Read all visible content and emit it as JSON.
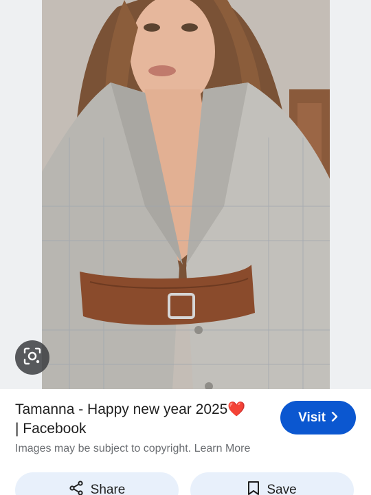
{
  "result": {
    "title_line1": "Tamanna - Happy new year 2025",
    "title_emoji": "❤️",
    "title_line2": "| Facebook",
    "copyright_text": "Images may be subject to copyright.",
    "learn_more": "Learn More"
  },
  "actions": {
    "visit_label": "Visit",
    "share_label": "Share",
    "save_label": "Save"
  },
  "icons": {
    "lens": "google-lens-icon",
    "visit": "chevron-right-icon",
    "share": "share-icon",
    "save": "bookmark-icon"
  },
  "colors": {
    "accent": "#0b57d0",
    "secondary_button": "#e8f0fb",
    "heart": "#e53935"
  }
}
